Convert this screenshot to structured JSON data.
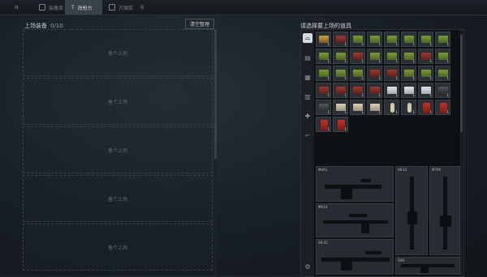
{
  "tabs": [
    {
      "key": "N",
      "label": "装备库"
    },
    {
      "key": "T",
      "label": "改枪台"
    },
    {
      "key": "Y",
      "label": "方案库"
    },
    {
      "key": "B",
      "label": ""
    }
  ],
  "left": {
    "title": "上场装备",
    "count": "0/10",
    "clear_label": "清空整理",
    "slot_label": "备个上场",
    "slot_count": 5
  },
  "right": {
    "title": "请选择要上场的道具",
    "categories": [
      "helmet",
      "armor",
      "rig",
      "backpack",
      "consumable",
      "weapon"
    ],
    "items": [
      {
        "shape": "gold",
        "count": "1"
      },
      {
        "shape": "red",
        "count": "1"
      },
      {
        "shape": "green",
        "count": "1"
      },
      {
        "shape": "green",
        "count": "1"
      },
      {
        "shape": "green",
        "count": "1"
      },
      {
        "shape": "green",
        "count": "1"
      },
      {
        "shape": "green",
        "count": "1"
      },
      {
        "shape": "green",
        "count": "1"
      },
      {
        "shape": "green",
        "count": "1"
      },
      {
        "shape": "green",
        "count": "1"
      },
      {
        "shape": "red",
        "count": "1"
      },
      {
        "shape": "green",
        "count": "1"
      },
      {
        "shape": "green",
        "count": "1"
      },
      {
        "shape": "green",
        "count": "1"
      },
      {
        "shape": "red",
        "count": "1"
      },
      {
        "shape": "green",
        "count": "1"
      },
      {
        "shape": "green",
        "count": "1"
      },
      {
        "shape": "green",
        "count": "1"
      },
      {
        "shape": "green",
        "count": "1"
      },
      {
        "shape": "red",
        "count": "1"
      },
      {
        "shape": "red",
        "count": "1"
      },
      {
        "shape": "green",
        "count": "1"
      },
      {
        "shape": "green",
        "count": "1"
      },
      {
        "shape": "green",
        "count": "1"
      },
      {
        "shape": "red",
        "count": "1"
      },
      {
        "shape": "red",
        "count": "1"
      },
      {
        "shape": "red",
        "count": "1"
      },
      {
        "shape": "red",
        "count": "1"
      },
      {
        "shape": "white",
        "count": "1"
      },
      {
        "shape": "white",
        "count": "1"
      },
      {
        "shape": "white",
        "count": "1"
      },
      {
        "shape": "dark",
        "count": "1"
      },
      {
        "shape": "dark",
        "count": "1"
      },
      {
        "shape": "box",
        "count": "1"
      },
      {
        "shape": "box",
        "count": "1"
      },
      {
        "shape": "box",
        "count": "1"
      },
      {
        "shape": "pill",
        "count": "1"
      },
      {
        "shape": "pill",
        "count": "1"
      },
      {
        "shape": "tag",
        "count": "1"
      },
      {
        "shape": "tag",
        "count": "1"
      },
      {
        "shape": "tag",
        "count": "1"
      },
      {
        "shape": "tag",
        "count": "1"
      }
    ],
    "weapons": [
      {
        "label": "M4A1"
      },
      {
        "label": "AK-12"
      },
      {
        "label": "M700"
      },
      {
        "label": "MK14"
      },
      {
        "label": "SR-25"
      },
      {
        "label": "SVD"
      }
    ]
  }
}
